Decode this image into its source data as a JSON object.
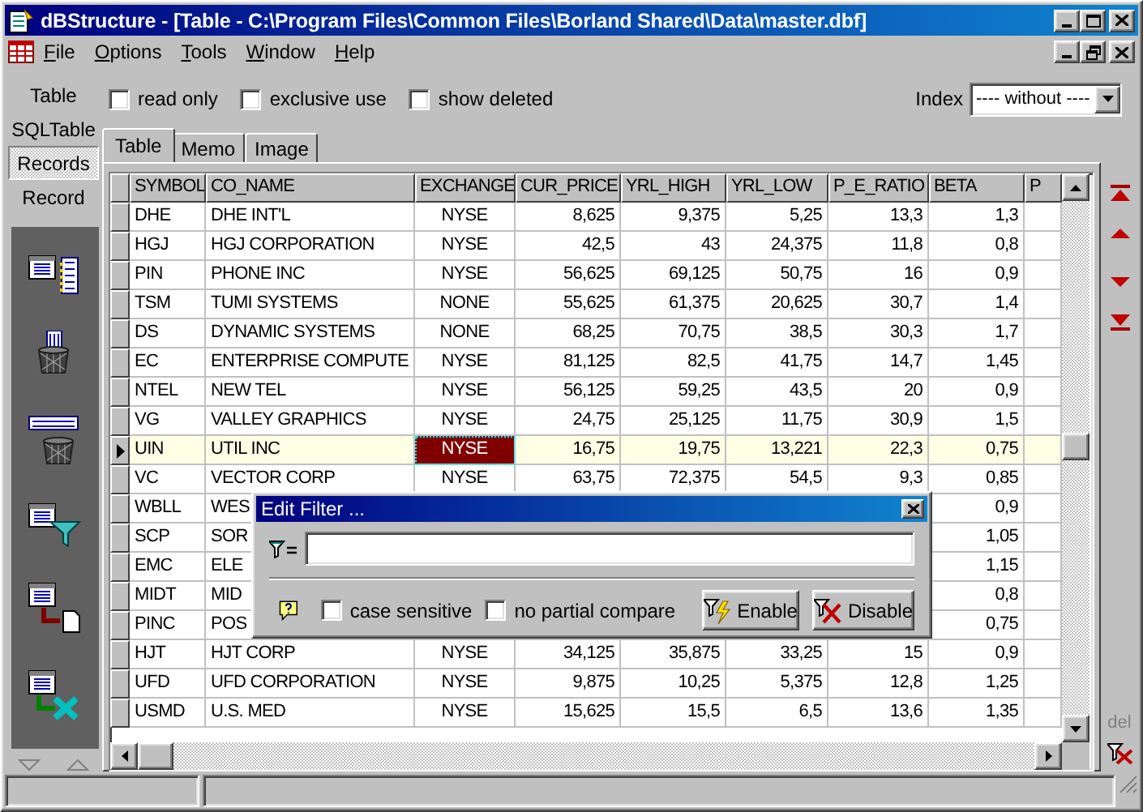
{
  "window": {
    "title": "dBStructure - [Table - C:\\Program Files\\Common Files\\Borland Shared\\Data\\master.dbf]"
  },
  "menu": [
    "File",
    "Options",
    "Tools",
    "Window",
    "Help"
  ],
  "options": [
    {
      "label": "read only",
      "checked": false
    },
    {
      "label": "exclusive use",
      "checked": false
    },
    {
      "label": "show deleted",
      "checked": false
    }
  ],
  "index": {
    "label": "Index",
    "value": "---- without ----"
  },
  "side_items": [
    {
      "label": "Table",
      "selected": false
    },
    {
      "label": "SQLTable",
      "selected": false
    },
    {
      "label": "Records",
      "selected": true
    },
    {
      "label": "Record",
      "selected": false
    }
  ],
  "tabs": [
    {
      "label": "Table",
      "selected": true
    },
    {
      "label": "Memo",
      "selected": false
    },
    {
      "label": "Image",
      "selected": false
    }
  ],
  "table": {
    "columns": [
      "SYMBOL",
      "CO_NAME",
      "EXCHANGE",
      "CUR_PRICE",
      "YRL_HIGH",
      "YRL_LOW",
      "P_E_RATIO",
      "BETA",
      "P"
    ],
    "rows": [
      {
        "selected": false,
        "cells": [
          "DHE",
          "DHE INT'L",
          "NYSE",
          "8,625",
          "9,375",
          "5,25",
          "13,3",
          "1,3"
        ]
      },
      {
        "selected": false,
        "cells": [
          "HGJ",
          "HGJ CORPORATION",
          "NYSE",
          "42,5",
          "43",
          "24,375",
          "11,8",
          "0,8"
        ]
      },
      {
        "selected": false,
        "cells": [
          "PIN",
          "PHONE INC",
          "NYSE",
          "56,625",
          "69,125",
          "50,75",
          "16",
          "0,9"
        ]
      },
      {
        "selected": false,
        "cells": [
          "TSM",
          "TUMI SYSTEMS",
          "NONE",
          "55,625",
          "61,375",
          "20,625",
          "30,7",
          "1,4"
        ]
      },
      {
        "selected": false,
        "cells": [
          "DS",
          "DYNAMIC SYSTEMS",
          "NONE",
          "68,25",
          "70,75",
          "38,5",
          "30,3",
          "1,7"
        ]
      },
      {
        "selected": false,
        "cells": [
          "EC",
          "ENTERPRISE COMPUTE",
          "NYSE",
          "81,125",
          "82,5",
          "41,75",
          "14,7",
          "1,45"
        ]
      },
      {
        "selected": false,
        "cells": [
          "NTEL",
          "NEW TEL",
          "NYSE",
          "56,125",
          "59,25",
          "43,5",
          "20",
          "0,9"
        ]
      },
      {
        "selected": false,
        "cells": [
          "VG",
          "VALLEY GRAPHICS",
          "NYSE",
          "24,75",
          "25,125",
          "11,75",
          "30,9",
          "1,5"
        ]
      },
      {
        "selected": true,
        "cells": [
          "UIN",
          "UTIL INC",
          "NYSE",
          "16,75",
          "19,75",
          "13,221",
          "22,3",
          "0,75"
        ]
      },
      {
        "selected": false,
        "cells": [
          "VC",
          "VECTOR CORP",
          "NYSE",
          "63,75",
          "72,375",
          "54,5",
          "9,3",
          "0,85"
        ]
      },
      {
        "selected": false,
        "cells": [
          "WBLL",
          "WES",
          null,
          null,
          null,
          null,
          null,
          "0,9"
        ]
      },
      {
        "selected": false,
        "cells": [
          "SCP",
          "SOR",
          null,
          null,
          null,
          null,
          null,
          "1,05"
        ]
      },
      {
        "selected": false,
        "cells": [
          "EMC",
          "ELE",
          null,
          null,
          null,
          null,
          null,
          "1,15"
        ]
      },
      {
        "selected": false,
        "cells": [
          "MIDT",
          "MID",
          null,
          null,
          null,
          null,
          null,
          "0,8"
        ]
      },
      {
        "selected": false,
        "cells": [
          "PINC",
          "POS",
          null,
          null,
          null,
          null,
          null,
          "0,75"
        ]
      },
      {
        "selected": false,
        "cells": [
          "HJT",
          "HJT CORP",
          "NYSE",
          "34,125",
          "35,875",
          "33,25",
          "15",
          "0,9"
        ]
      },
      {
        "selected": false,
        "cells": [
          "UFD",
          "UFD CORPORATION",
          "NYSE",
          "9,875",
          "10,25",
          "5,375",
          "12,8",
          "1,25"
        ]
      },
      {
        "selected": false,
        "cells": [
          "USMD",
          "U.S. MED",
          "NYSE",
          "15,625",
          "15,5",
          "6,5",
          "13,6",
          "1,35"
        ]
      }
    ]
  },
  "del_label": "del",
  "filter_dialog": {
    "title": "Edit Filter ...",
    "options": [
      {
        "label": "case sensitive",
        "checked": false
      },
      {
        "label": "no partial compare",
        "checked": false
      }
    ],
    "buttons": [
      {
        "label": "Enable",
        "kind": "enable"
      },
      {
        "label": "Disable",
        "kind": "disable"
      }
    ]
  }
}
